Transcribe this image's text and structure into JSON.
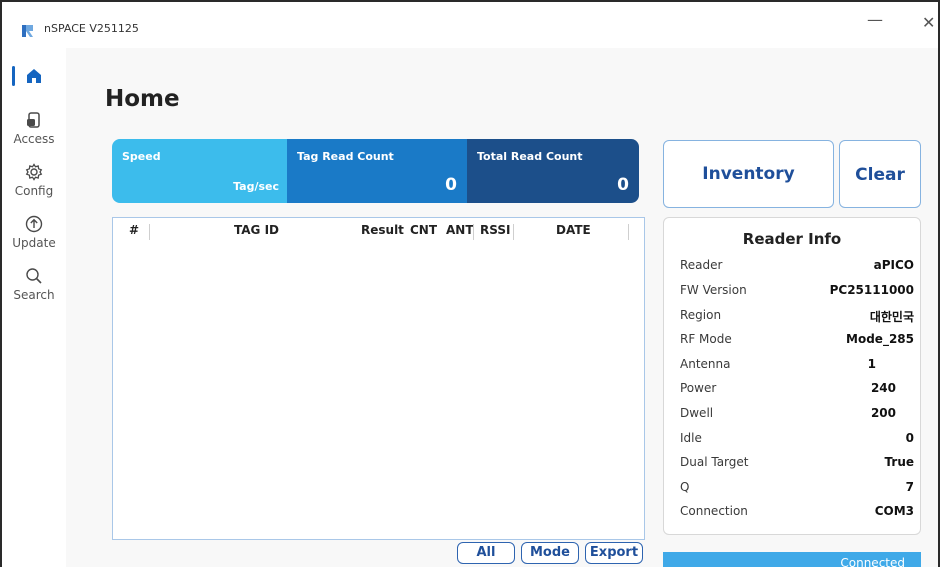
{
  "window": {
    "title": "nSPACE V251125",
    "minimize_glyph": "—",
    "close_glyph": "✕"
  },
  "sidebar": {
    "items": [
      {
        "label": "",
        "icon": "home-icon",
        "active": true
      },
      {
        "label": "Access",
        "icon": "access-icon"
      },
      {
        "label": "Config",
        "icon": "gear-icon"
      },
      {
        "label": "Update",
        "icon": "update-icon"
      },
      {
        "label": "Search",
        "icon": "search-icon"
      }
    ]
  },
  "page": {
    "title": "Home"
  },
  "stats": {
    "speed": {
      "label": "Speed",
      "unit": "Tag/sec",
      "value": ""
    },
    "tag_read_count": {
      "label": "Tag Read Count",
      "value": "0"
    },
    "total_read_count": {
      "label": "Total Read Count",
      "value": "0"
    }
  },
  "table": {
    "columns": [
      "#",
      "TAG ID",
      "Result",
      "CNT",
      "ANT",
      "RSSI",
      "DATE"
    ],
    "rows": []
  },
  "table_actions": {
    "all": "All",
    "mode": "Mode",
    "export": "Export"
  },
  "actions": {
    "inventory": "Inventory",
    "clear": "Clear"
  },
  "reader_info": {
    "title": "Reader Info",
    "rows": [
      {
        "key": "Reader",
        "value": "aPICO"
      },
      {
        "key": "FW Version",
        "value": "PC25111000"
      },
      {
        "key": "Region",
        "value": "대한민국"
      },
      {
        "key": "RF Mode",
        "value": "Mode_285"
      },
      {
        "key": "Antenna",
        "value": "1"
      },
      {
        "key": "Power",
        "value": "240"
      },
      {
        "key": "Dwell",
        "value": "200"
      },
      {
        "key": "Idle",
        "value": "0"
      },
      {
        "key": "Dual Target",
        "value": "True"
      },
      {
        "key": "Q",
        "value": "7"
      },
      {
        "key": "Connection",
        "value": "COM3"
      }
    ]
  },
  "status": {
    "text": "Connected"
  },
  "colors": {
    "speed_bg": "#3cbcec",
    "tag_bg": "#1a7ac7",
    "total_bg": "#1c4f8a",
    "accent": "#1f4f9a",
    "status_bg": "#3fa9e8"
  }
}
